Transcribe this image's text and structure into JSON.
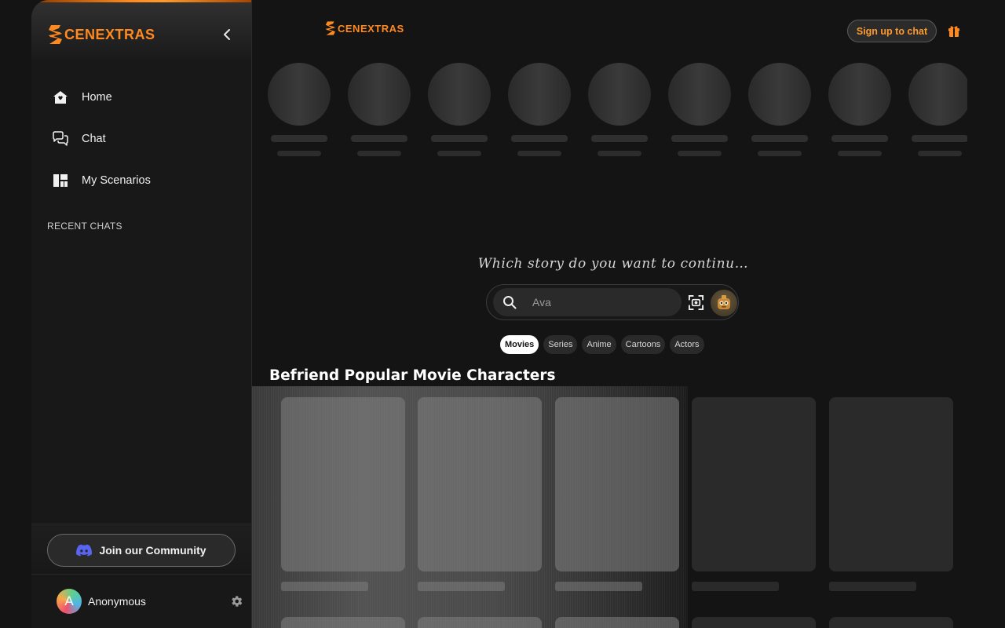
{
  "brand": {
    "name": "CENEXTRAS",
    "mark": "S",
    "color": "#ff8a1f"
  },
  "sidebar": {
    "nav": [
      {
        "label": "Home",
        "icon": "home-icon"
      },
      {
        "label": "Chat",
        "icon": "chat-icon"
      },
      {
        "label": "My Scenarios",
        "icon": "grid-icon"
      }
    ],
    "recent_title": "RECENT CHATS",
    "community_label": "Join our Community",
    "user": {
      "initial": "A",
      "name": "Anonymous"
    }
  },
  "header": {
    "signup_label": "Sign up to chat"
  },
  "search": {
    "prompt": "Which story do you want to continu…",
    "placeholder": "Ava"
  },
  "chips": [
    {
      "label": "Movies",
      "active": true
    },
    {
      "label": "Series",
      "active": false
    },
    {
      "label": "Anime",
      "active": false
    },
    {
      "label": "Cartoons",
      "active": false
    },
    {
      "label": "Actors",
      "active": false
    }
  ],
  "section": {
    "title": "Befriend Popular Movie Characters"
  },
  "colors": {
    "accent": "#ff8a1f",
    "background": "#141414",
    "sidebar": "#181818",
    "discord": "#5865f2"
  }
}
